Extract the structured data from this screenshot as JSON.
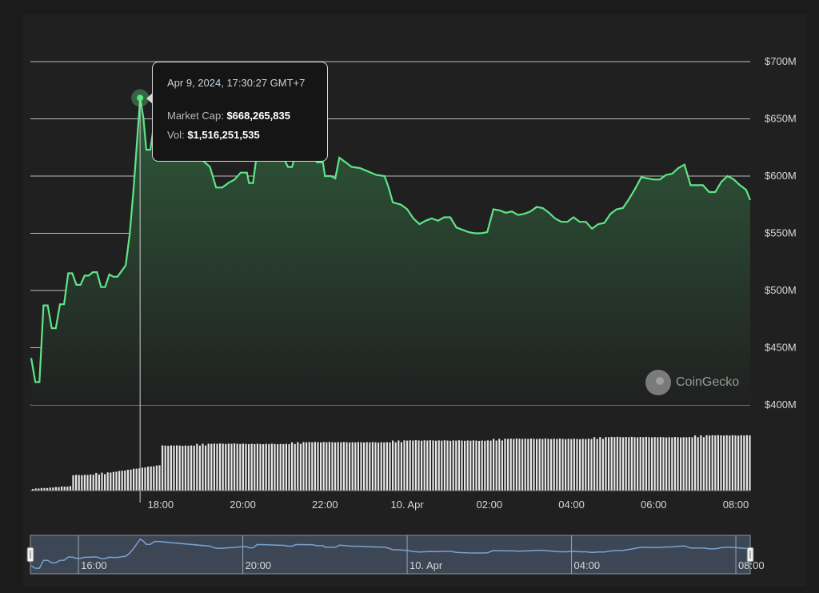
{
  "colors": {
    "line": "#5ee587",
    "area_top": "#2f5a3a",
    "area_bottom": "#202020",
    "plot_bg": "#202020",
    "page_bg": "#1b1b1b",
    "grid": "#bdbdbd",
    "volume": "#e6e6e6",
    "navigator_line": "#7aa3d1",
    "navigator_bg": "#3c4654"
  },
  "tooltip": {
    "date": "Apr 9, 2024, 17:30:27 GMT+7",
    "market_cap_label": "Market Cap:",
    "market_cap_value": "$668,265,835",
    "vol_label": "Vol:",
    "vol_value": "$1,516,251,535"
  },
  "watermark": {
    "text": "CoinGecko",
    "icon": "coingecko-logo-icon"
  },
  "chart_data": {
    "type": "area",
    "title": "",
    "xlabel": "",
    "ylabel": "",
    "ylim": [
      400,
      700
    ],
    "y_unit": "$M",
    "y_ticks": [
      "$700M",
      "$650M",
      "$600M",
      "$550M",
      "$500M",
      "$450M",
      "$400M"
    ],
    "y_tick_values": [
      700,
      650,
      600,
      550,
      500,
      450,
      400
    ],
    "x_ticks": [
      "18:00",
      "20:00",
      "22:00",
      "10. Apr",
      "02:00",
      "04:00",
      "06:00",
      "08:00"
    ],
    "x_tick_hours": [
      18,
      20,
      22,
      24,
      26,
      28,
      30,
      32
    ],
    "x_range_hours": [
      14.83,
      32.35
    ],
    "highlight": {
      "x_hour": 17.5,
      "y": 668.27
    },
    "series": [
      {
        "values": [
          [
            14.85,
            441
          ],
          [
            14.95,
            420
          ],
          [
            15.05,
            420
          ],
          [
            15.15,
            487
          ],
          [
            15.25,
            487
          ],
          [
            15.35,
            467
          ],
          [
            15.45,
            467
          ],
          [
            15.55,
            488
          ],
          [
            15.65,
            488
          ],
          [
            15.75,
            515
          ],
          [
            15.85,
            515
          ],
          [
            15.95,
            505
          ],
          [
            16.05,
            505
          ],
          [
            16.15,
            513
          ],
          [
            16.25,
            513
          ],
          [
            16.35,
            516
          ],
          [
            16.45,
            516
          ],
          [
            16.55,
            503
          ],
          [
            16.65,
            503
          ],
          [
            16.75,
            514
          ],
          [
            16.85,
            512
          ],
          [
            16.95,
            512
          ],
          [
            17.05,
            517
          ],
          [
            17.15,
            522
          ],
          [
            17.25,
            550
          ],
          [
            17.35,
            593
          ],
          [
            17.5,
            668
          ],
          [
            17.58,
            651
          ],
          [
            17.65,
            623
          ],
          [
            17.75,
            623
          ],
          [
            17.85,
            648
          ],
          [
            17.95,
            648
          ],
          [
            19.2,
            608
          ],
          [
            19.35,
            590
          ],
          [
            19.5,
            590
          ],
          [
            19.65,
            594
          ],
          [
            19.8,
            597
          ],
          [
            19.95,
            603
          ],
          [
            20.1,
            603
          ],
          [
            20.15,
            594
          ],
          [
            20.25,
            594
          ],
          [
            20.35,
            622
          ],
          [
            21.0,
            615
          ],
          [
            21.1,
            608
          ],
          [
            21.2,
            608
          ],
          [
            21.3,
            622
          ],
          [
            21.7,
            620
          ],
          [
            21.8,
            612
          ],
          [
            21.95,
            612
          ],
          [
            22.0,
            600
          ],
          [
            22.15,
            600
          ],
          [
            22.25,
            598
          ],
          [
            22.35,
            616
          ],
          [
            22.5,
            612
          ],
          [
            22.65,
            608
          ],
          [
            22.85,
            607
          ],
          [
            23.05,
            604
          ],
          [
            23.25,
            601
          ],
          [
            23.45,
            600
          ],
          [
            23.55,
            590
          ],
          [
            23.65,
            577
          ],
          [
            23.85,
            575
          ],
          [
            24.0,
            571
          ],
          [
            24.15,
            563
          ],
          [
            24.3,
            558
          ],
          [
            24.45,
            561
          ],
          [
            24.6,
            563
          ],
          [
            24.75,
            561
          ],
          [
            24.9,
            564
          ],
          [
            25.05,
            564
          ],
          [
            25.2,
            555
          ],
          [
            25.35,
            553
          ],
          [
            25.5,
            551
          ],
          [
            25.65,
            550
          ],
          [
            25.8,
            550
          ],
          [
            25.95,
            551
          ],
          [
            26.1,
            571
          ],
          [
            26.25,
            570
          ],
          [
            26.4,
            568
          ],
          [
            26.55,
            569
          ],
          [
            26.7,
            566
          ],
          [
            26.85,
            567
          ],
          [
            27.0,
            569
          ],
          [
            27.15,
            573
          ],
          [
            27.3,
            572
          ],
          [
            27.45,
            568
          ],
          [
            27.6,
            563
          ],
          [
            27.75,
            560
          ],
          [
            27.9,
            560
          ],
          [
            28.05,
            564
          ],
          [
            28.2,
            560
          ],
          [
            28.35,
            560
          ],
          [
            28.5,
            554
          ],
          [
            28.65,
            558
          ],
          [
            28.8,
            559
          ],
          [
            28.95,
            567
          ],
          [
            29.1,
            571
          ],
          [
            29.25,
            572
          ],
          [
            29.4,
            580
          ],
          [
            29.55,
            589
          ],
          [
            29.7,
            599
          ],
          [
            29.85,
            598
          ],
          [
            30.0,
            597
          ],
          [
            30.15,
            597
          ],
          [
            30.3,
            601
          ],
          [
            30.45,
            602
          ],
          [
            30.6,
            607
          ],
          [
            30.75,
            610
          ],
          [
            30.9,
            592
          ],
          [
            31.05,
            592
          ],
          [
            31.2,
            592
          ],
          [
            31.35,
            586
          ],
          [
            31.5,
            586
          ],
          [
            31.65,
            595
          ],
          [
            31.8,
            600
          ],
          [
            31.95,
            597
          ],
          [
            32.1,
            592
          ],
          [
            32.25,
            588
          ],
          [
            32.35,
            579
          ]
        ]
      }
    ],
    "volume_note": "relative trading volume bars, rising from near zero to roughly 60% of panel height",
    "navigator": {
      "x_ticks": [
        "16:00",
        "20:00",
        "10. Apr",
        "04:00",
        "08:00"
      ],
      "x_tick_hours": [
        16,
        20,
        24,
        28,
        32
      ],
      "x_range_hours": [
        14.83,
        32.35
      ]
    }
  }
}
